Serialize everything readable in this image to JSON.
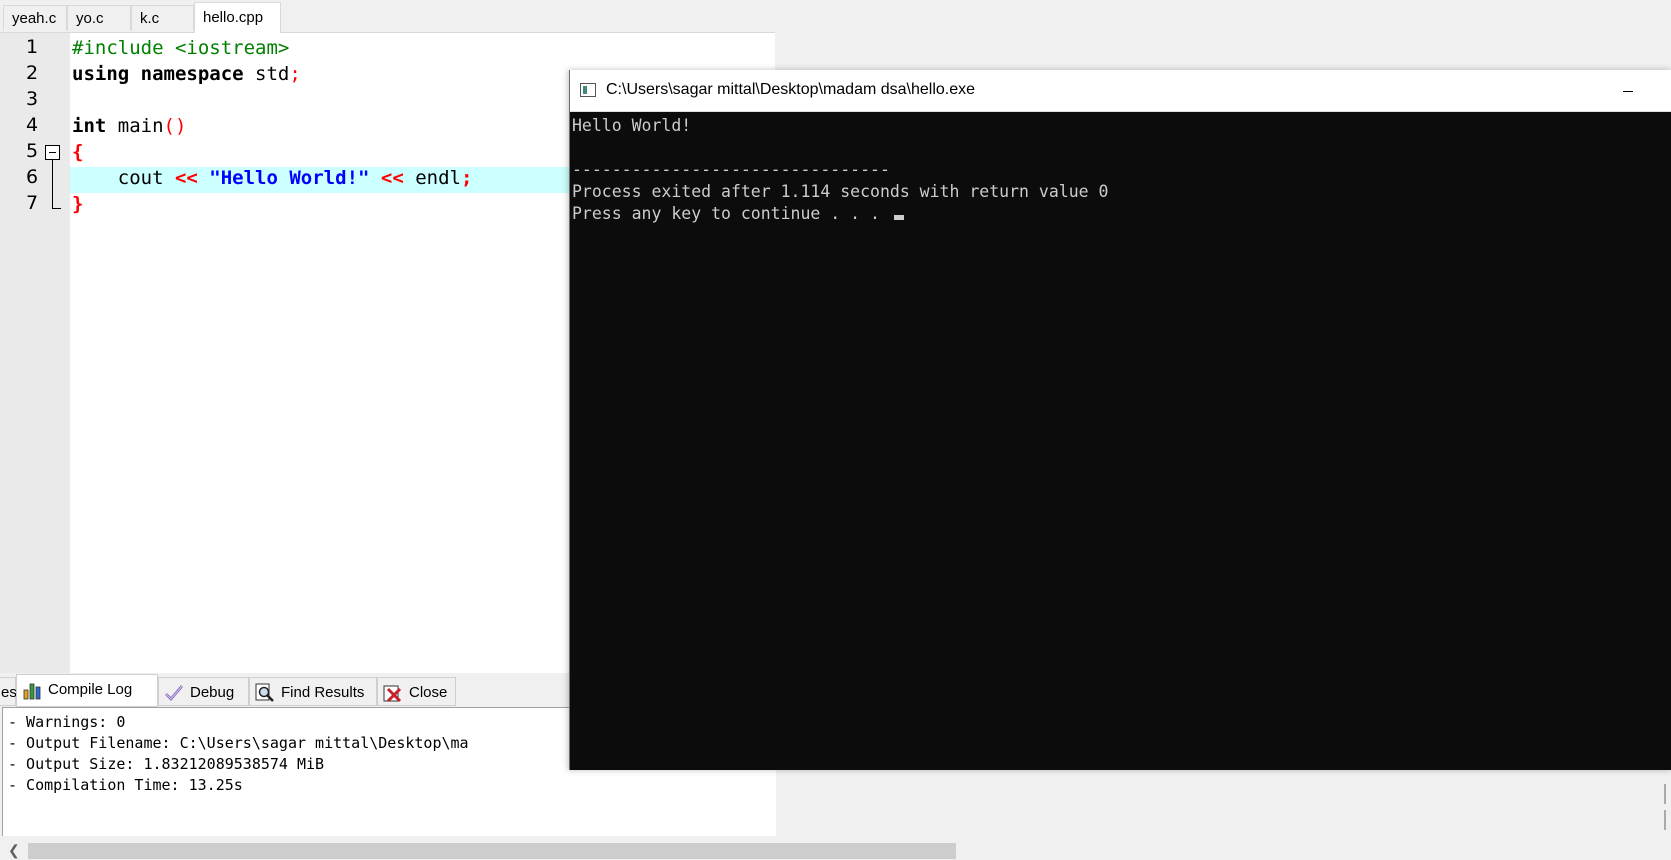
{
  "tabs": [
    {
      "label": "yeah.c"
    },
    {
      "label": "yo.c"
    },
    {
      "label": "k.c"
    },
    {
      "label": "hello.cpp",
      "active": true
    }
  ],
  "editor": {
    "line_numbers": [
      "1",
      "2",
      "3",
      "4",
      "5",
      "6",
      "7"
    ],
    "highlighted_line": 6,
    "code": {
      "l1": "#include <iostream>",
      "l2_kw": "using namespace",
      "l2_rest": " std",
      "l2_semi": ";",
      "l4_kw": "int",
      "l4_name": " main",
      "l4_paren": "()",
      "l5": "{",
      "l6_indent": "    cout ",
      "l6_op1": "<<",
      "l6_str": "\"Hello World!\"",
      "l6_op2": "<<",
      "l6_endl": " endl",
      "l6_semi": ";",
      "l7": "}"
    }
  },
  "bottom_panel": {
    "tabs": [
      {
        "label": "es",
        "icon": "resources-icon"
      },
      {
        "label": "Compile Log",
        "icon": "bar-chart-icon",
        "active": true
      },
      {
        "label": "Debug",
        "icon": "checkmark-icon"
      },
      {
        "label": "Find Results",
        "icon": "magnifier-icon"
      },
      {
        "label": "Close",
        "icon": "close-icon"
      }
    ],
    "log_lines": [
      "- Warnings: 0",
      "- Output Filename: C:\\Users\\sagar mittal\\Desktop\\ma",
      "- Output Size: 1.83212089538574 MiB",
      "- Compilation Time: 13.25s"
    ]
  },
  "console": {
    "title": "C:\\Users\\sagar mittal\\Desktop\\madam dsa\\hello.exe",
    "lines": [
      "Hello World!",
      "",
      "--------------------------------",
      "Process exited after 1.114 seconds with return value 0",
      "Press any key to continue . . . "
    ]
  },
  "colors": {
    "preprocessor": "#008000",
    "operator": "#ff0000",
    "string": "#0000ff",
    "highlight_line": "#ccffff",
    "console_bg": "#0c0c0c",
    "console_text": "#cccccc"
  }
}
